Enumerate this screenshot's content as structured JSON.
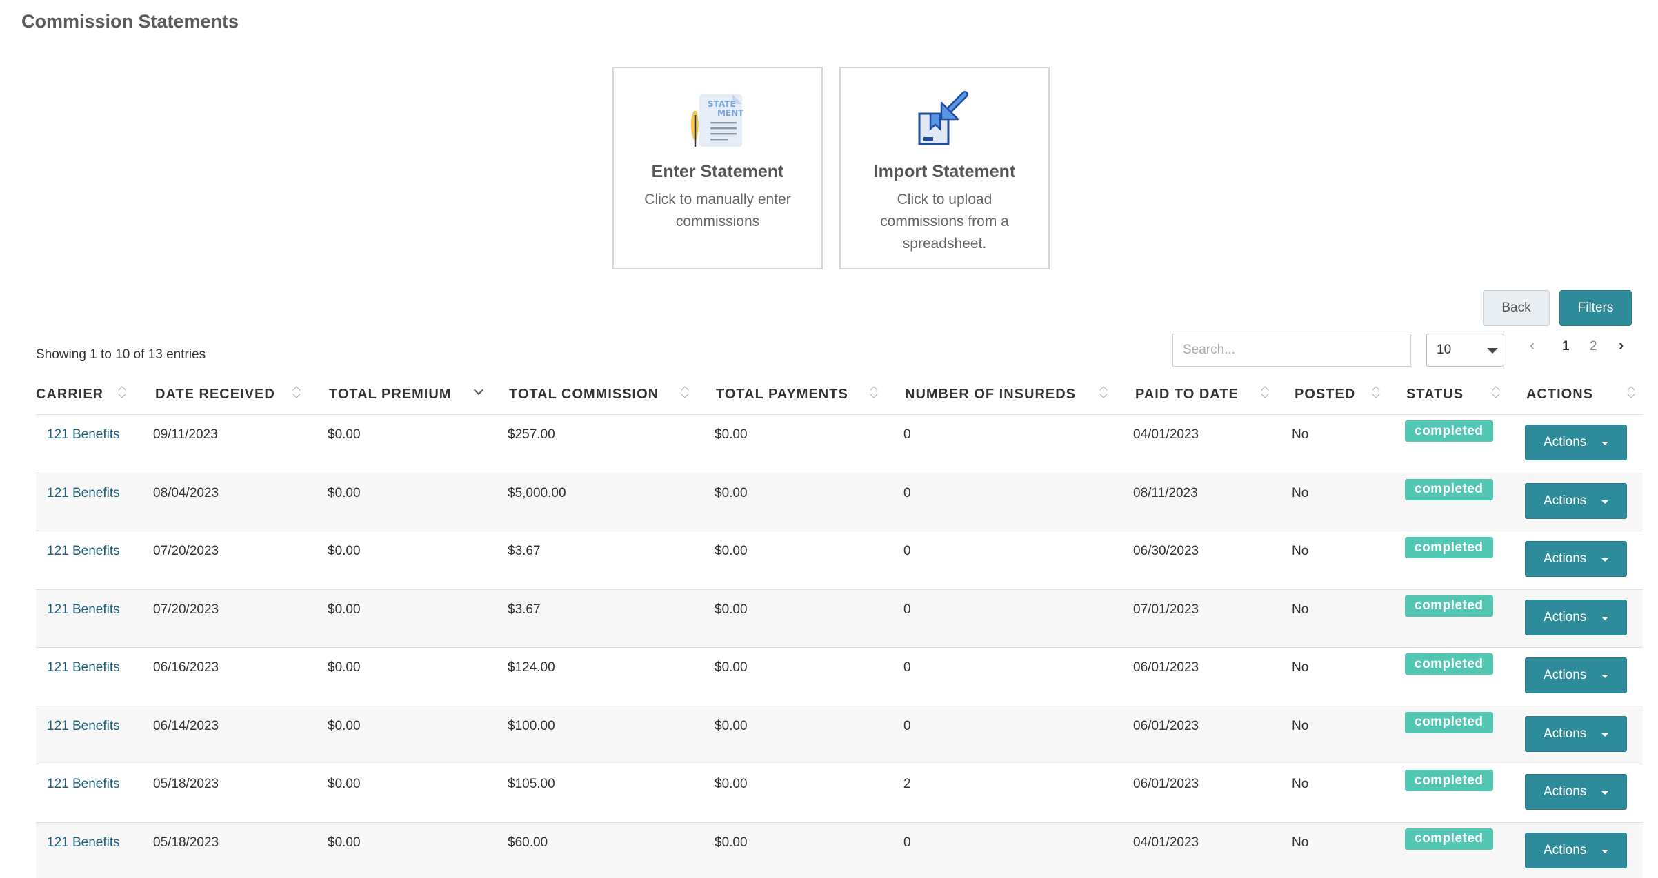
{
  "page": {
    "title": "Commission Statements"
  },
  "cards": [
    {
      "title": "Enter Statement",
      "desc": "Click to manually enter commissions",
      "icon": "statement-document-icon",
      "icon_text_1": "STATE",
      "icon_text_2": "MENT"
    },
    {
      "title": "Import Statement",
      "desc": "Click to upload commissions from a spreadsheet.",
      "icon": "import-box-icon"
    }
  ],
  "toolbar": {
    "back_label": "Back",
    "filters_label": "Filters"
  },
  "table_info": {
    "showing": "Showing 1 to 10 of 13 entries"
  },
  "search": {
    "placeholder": "Search..."
  },
  "page_size": {
    "selected": "10"
  },
  "pagination": {
    "prev": "‹",
    "pages": [
      "1",
      "2"
    ],
    "current": "1",
    "next": "›"
  },
  "columns": [
    "CARRIER",
    "DATE RECEIVED",
    "TOTAL PREMIUM",
    "TOTAL COMMISSION",
    "TOTAL PAYMENTS",
    "NUMBER OF INSUREDS",
    "PAID TO DATE",
    "POSTED",
    "STATUS",
    "ACTIONS"
  ],
  "rows": [
    {
      "carrier": "121 Benefits",
      "date_received": "09/11/2023",
      "total_premium": "$0.00",
      "total_commission": "$257.00",
      "total_payments": "$0.00",
      "insureds": "0",
      "paid_to_date": "04/01/2023",
      "posted": "No",
      "status": "completed",
      "action": "Actions"
    },
    {
      "carrier": "121 Benefits",
      "date_received": "08/04/2023",
      "total_premium": "$0.00",
      "total_commission": "$5,000.00",
      "total_payments": "$0.00",
      "insureds": "0",
      "paid_to_date": "08/11/2023",
      "posted": "No",
      "status": "completed",
      "action": "Actions"
    },
    {
      "carrier": "121 Benefits",
      "date_received": "07/20/2023",
      "total_premium": "$0.00",
      "total_commission": "$3.67",
      "total_payments": "$0.00",
      "insureds": "0",
      "paid_to_date": "06/30/2023",
      "posted": "No",
      "status": "completed",
      "action": "Actions"
    },
    {
      "carrier": "121 Benefits",
      "date_received": "07/20/2023",
      "total_premium": "$0.00",
      "total_commission": "$3.67",
      "total_payments": "$0.00",
      "insureds": "0",
      "paid_to_date": "07/01/2023",
      "posted": "No",
      "status": "completed",
      "action": "Actions"
    },
    {
      "carrier": "121 Benefits",
      "date_received": "06/16/2023",
      "total_premium": "$0.00",
      "total_commission": "$124.00",
      "total_payments": "$0.00",
      "insureds": "0",
      "paid_to_date": "06/01/2023",
      "posted": "No",
      "status": "completed",
      "action": "Actions"
    },
    {
      "carrier": "121 Benefits",
      "date_received": "06/14/2023",
      "total_premium": "$0.00",
      "total_commission": "$100.00",
      "total_payments": "$0.00",
      "insureds": "0",
      "paid_to_date": "06/01/2023",
      "posted": "No",
      "status": "completed",
      "action": "Actions"
    },
    {
      "carrier": "121 Benefits",
      "date_received": "05/18/2023",
      "total_premium": "$0.00",
      "total_commission": "$105.00",
      "total_payments": "$0.00",
      "insureds": "2",
      "paid_to_date": "06/01/2023",
      "posted": "No",
      "status": "completed",
      "action": "Actions"
    },
    {
      "carrier": "121 Benefits",
      "date_received": "05/18/2023",
      "total_premium": "$0.00",
      "total_commission": "$60.00",
      "total_payments": "$0.00",
      "insureds": "0",
      "paid_to_date": "04/01/2023",
      "posted": "No",
      "status": "completed",
      "action": "Actions"
    }
  ],
  "colors": {
    "primary": "#2e8b9a",
    "status_completed": "#52c7b4",
    "link": "#1f5f7a"
  }
}
